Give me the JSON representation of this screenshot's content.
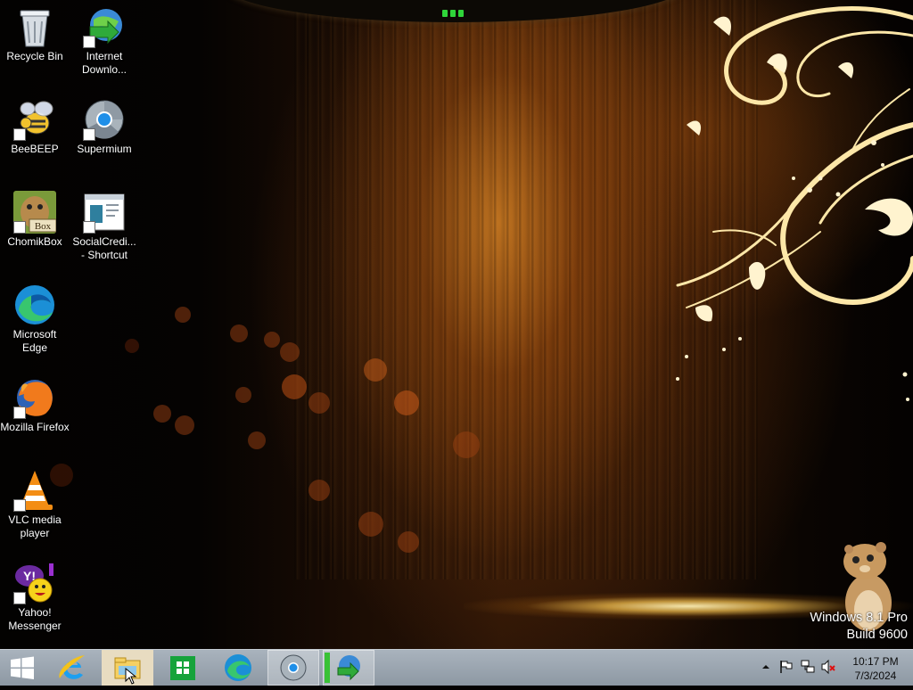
{
  "desktop": {
    "icons": [
      {
        "label": "Recycle Bin",
        "icon": "recycle-bin-icon"
      },
      {
        "label": "Internet Downlo...",
        "icon": "internet-download-manager-icon"
      },
      {
        "label": "BeeBEEP",
        "icon": "beebeep-icon"
      },
      {
        "label": "Supermium",
        "icon": "supermium-icon"
      },
      {
        "label": "ChomikBox",
        "icon": "chomikbox-icon"
      },
      {
        "label": "SocialCredi... - Shortcut",
        "icon": "socialcredit-shortcut-icon"
      },
      {
        "label": "Microsoft Edge",
        "icon": "microsoft-edge-icon"
      },
      {
        "label": "Mozilla Firefox",
        "icon": "firefox-icon"
      },
      {
        "label": "VLC media player",
        "icon": "vlc-icon"
      },
      {
        "label": "Yahoo! Messenger",
        "icon": "yahoo-messenger-icon"
      }
    ]
  },
  "watermark": {
    "line1": "Windows 8.1 Pro",
    "line2": "Build 9600"
  },
  "taskbar": {
    "items": [
      {
        "name": "internet-explorer",
        "icon": "internet-explorer-icon"
      },
      {
        "name": "file-explorer",
        "icon": "folder-icon"
      },
      {
        "name": "store",
        "icon": "store-icon"
      },
      {
        "name": "microsoft-edge",
        "icon": "edge-icon"
      },
      {
        "name": "supermium",
        "icon": "supermium-icon"
      },
      {
        "name": "internet-download-manager",
        "icon": "idm-icon"
      }
    ],
    "tray": {
      "icons": [
        "show-hidden-icons-arrow",
        "action-center-flag-icon",
        "network-icon",
        "volume-muted-icon"
      ],
      "time": "10:17 PM",
      "date": "7/3/2024"
    }
  },
  "colors": {
    "taskbar": "#9aa4ae",
    "active_highlight": "#e8dcc1",
    "text": "#ffffff"
  }
}
